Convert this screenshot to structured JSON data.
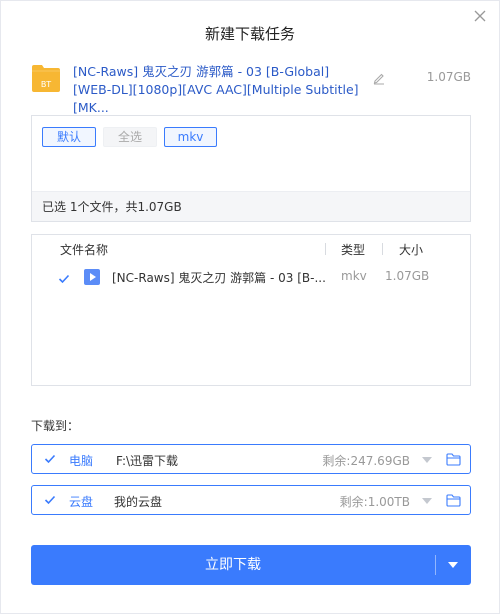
{
  "dialog": {
    "title": "新建下载任务"
  },
  "torrent": {
    "name": "[NC-Raws] 鬼灭之刃 游郭篇 - 03 [B-Global][WEB-DL][1080p][AVC AAC][Multiple Subtitle][MK...",
    "size": "1.07GB",
    "icon": "bt-file-icon",
    "icon_label": "BT"
  },
  "filters": {
    "chips": [
      "默认",
      "全选",
      "mkv"
    ],
    "status": "已选 1个文件，共1.07GB"
  },
  "file_list": {
    "columns": [
      "文件名称",
      "类型",
      "大小"
    ],
    "rows": [
      {
        "name": "[NC-Raws] 鬼灭之刃 游郭篇 - 03 [B-...",
        "type": "mkv",
        "size": "1.07GB",
        "checked": true
      }
    ]
  },
  "download_to": {
    "label": "下载到：",
    "destinations": [
      {
        "type": "电脑",
        "path": "F:\\迅雷下载",
        "free": "剩余:247.69GB",
        "checked": true
      },
      {
        "type": "云盘",
        "path": "我的云盘",
        "free": "剩余:1.00TB",
        "checked": true
      }
    ]
  },
  "actions": {
    "download_now": "立即下载"
  },
  "colors": {
    "accent": "#3a7bfd",
    "folder": "#f7b733",
    "muted": "#999999"
  }
}
